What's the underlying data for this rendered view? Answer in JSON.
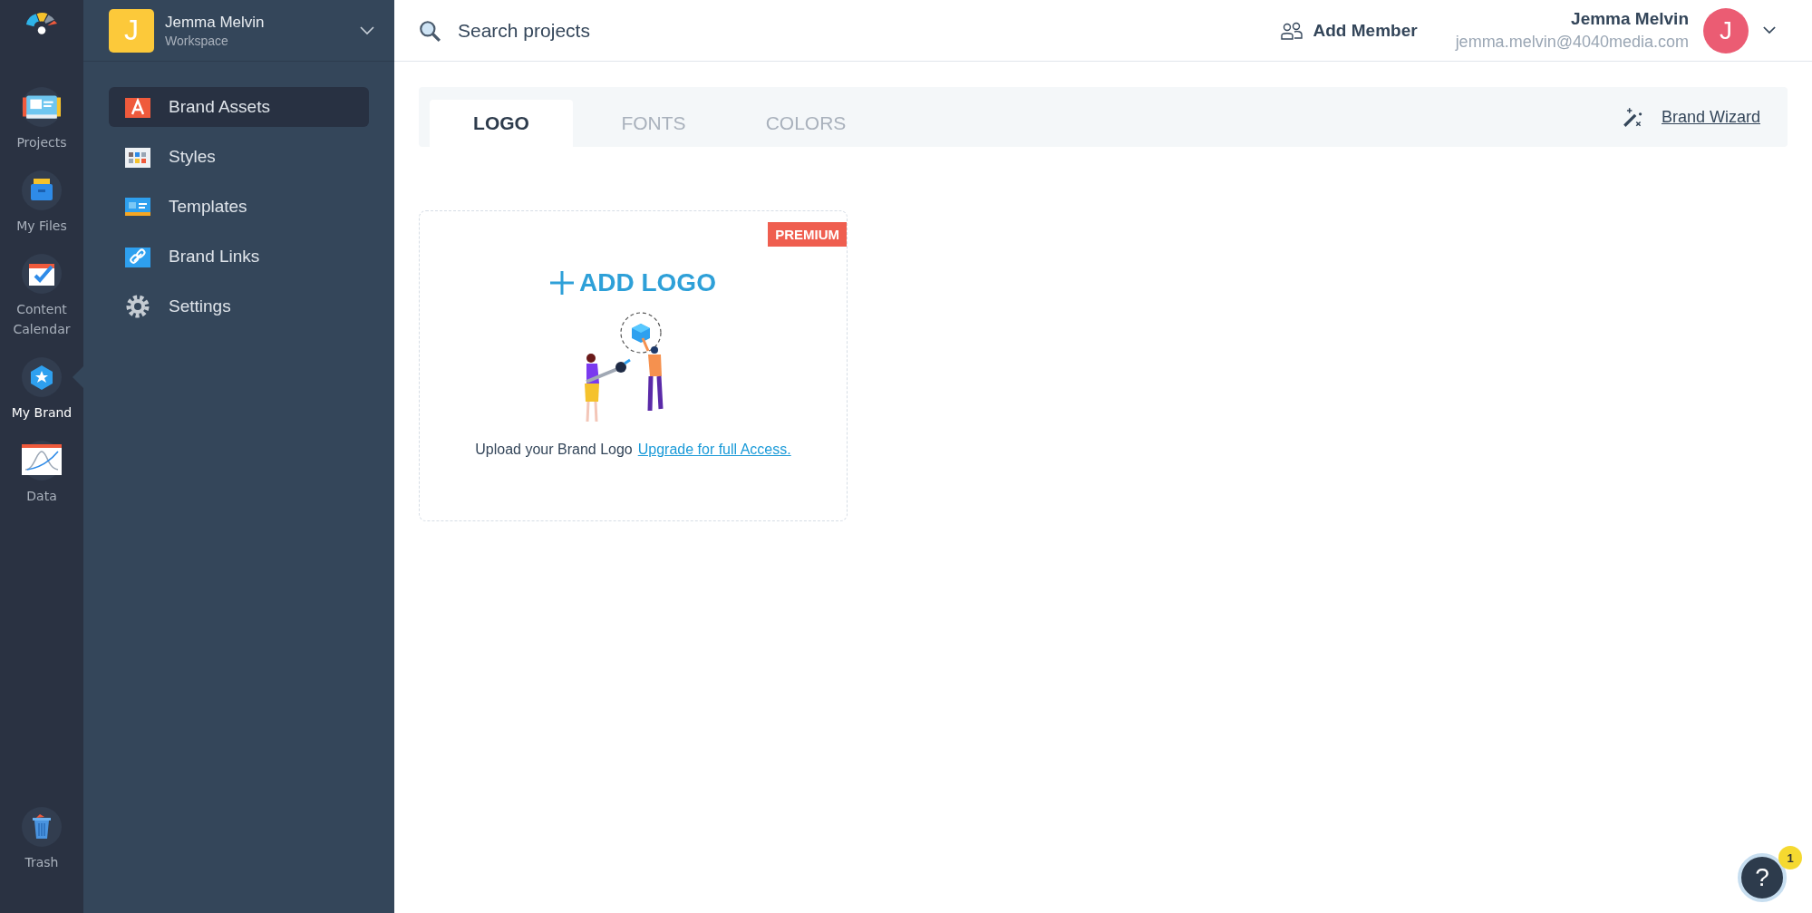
{
  "rail": {
    "items": [
      {
        "label": "Projects",
        "kind": "projects",
        "selected": false
      },
      {
        "label": "My Files",
        "kind": "files",
        "selected": false
      },
      {
        "label": "Content Calendar",
        "kind": "calendar",
        "selected": false
      },
      {
        "label": "My Brand",
        "kind": "brand",
        "selected": true
      },
      {
        "label": "Data",
        "kind": "data",
        "selected": false
      }
    ],
    "bottom": {
      "label": "Trash",
      "kind": "trash"
    }
  },
  "workspace": {
    "initial": "J",
    "name": "Jemma Melvin",
    "subtitle": "Workspace"
  },
  "sidebar": {
    "items": [
      {
        "label": "Brand Assets",
        "kind": "assets",
        "selected": true
      },
      {
        "label": "Styles",
        "kind": "styles",
        "selected": false
      },
      {
        "label": "Templates",
        "kind": "templates",
        "selected": false
      },
      {
        "label": "Brand Links",
        "kind": "links",
        "selected": false
      },
      {
        "label": "Settings",
        "kind": "settings",
        "selected": false
      }
    ]
  },
  "topbar": {
    "search": {
      "placeholder": "Search projects"
    },
    "add_member": "Add Member",
    "user": {
      "name": "Jemma Melvin",
      "email": "jemma.melvin@4040media.com",
      "initial": "J"
    }
  },
  "tabs": [
    {
      "label": "LOGO",
      "selected": true
    },
    {
      "label": "FONTS",
      "selected": false
    },
    {
      "label": "COLORS",
      "selected": false
    }
  ],
  "brand_wizard": "Brand Wizard",
  "logo_card": {
    "badge": "PREMIUM",
    "add_label": "ADD LOGO",
    "caption": "Upload your Brand Logo",
    "link": "Upgrade for full Access."
  },
  "help": {
    "label": "?",
    "badge": "1"
  }
}
